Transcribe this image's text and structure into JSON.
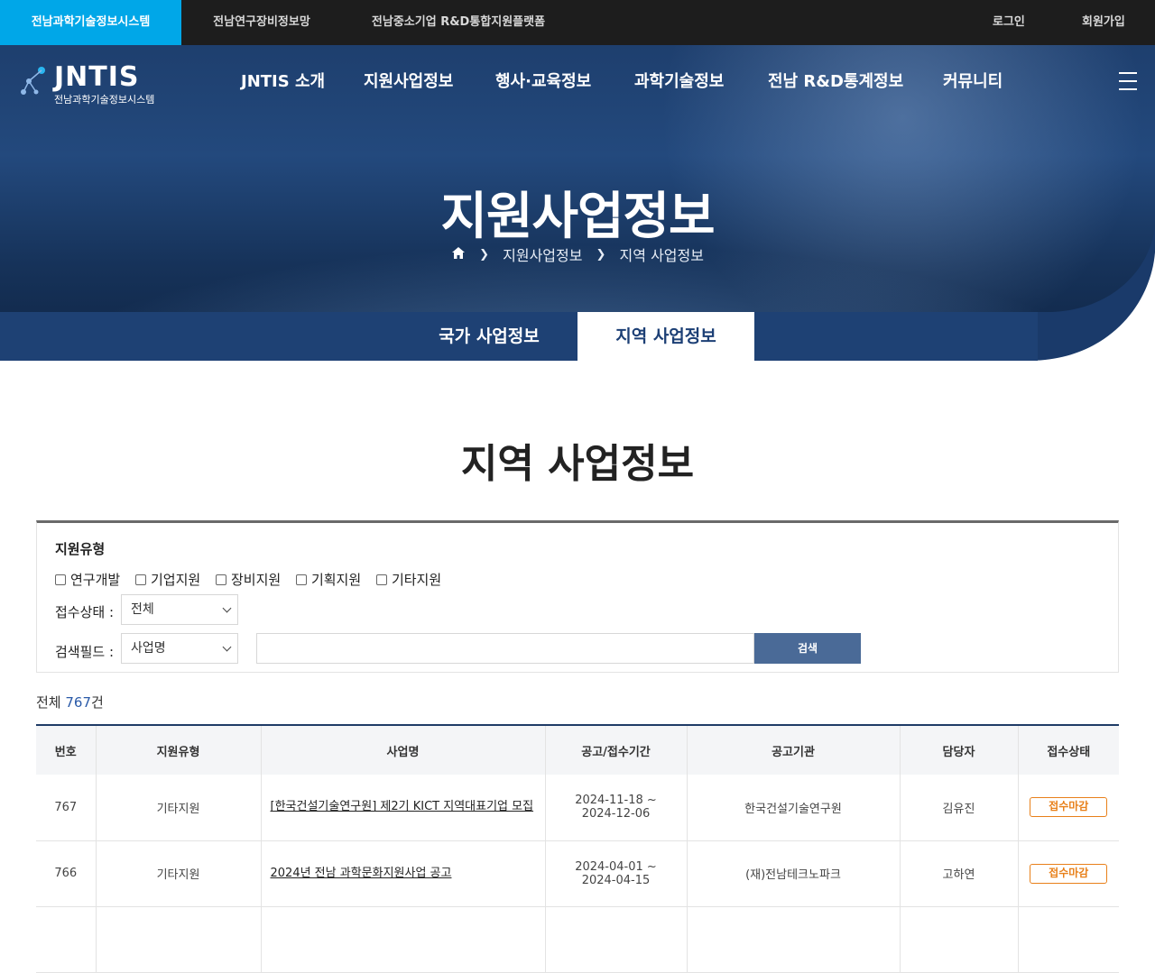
{
  "topbar": {
    "sites": [
      {
        "label": "전남과학기술정보시스템",
        "active": true
      },
      {
        "label": "전남연구장비정보망",
        "active": false
      },
      {
        "label": "전남중소기업 R&D통합지원플랫폼",
        "active": false
      }
    ],
    "login": "로그인",
    "signup": "회원가입"
  },
  "logo": {
    "text": "JNTIS",
    "sub": "전남과학기술정보시스템"
  },
  "gnb": [
    "JNTIS 소개",
    "지원사업정보",
    "행사·교육정보",
    "과학기술정보",
    "전남 R&D통계정보",
    "커뮤니티"
  ],
  "hero": {
    "title": "지원사업정보",
    "breadcrumb": [
      "지원사업정보",
      "지역 사업정보"
    ]
  },
  "subtabs": [
    {
      "label": "국가 사업정보",
      "active": false
    },
    {
      "label": "지역 사업정보",
      "active": true
    }
  ],
  "page_title": "지역 사업정보",
  "search": {
    "type_label": "지원유형",
    "types": [
      "연구개발",
      "기업지원",
      "장비지원",
      "기획지원",
      "기타지원"
    ],
    "status_label": "접수상태 :",
    "status_value": "전체",
    "field_label": "검색필드 :",
    "field_value": "사업명",
    "keyword": "",
    "button": "검색"
  },
  "total": {
    "prefix": "전체 ",
    "count": "767",
    "suffix": "건"
  },
  "table": {
    "headers": [
      "번호",
      "지원유형",
      "사업명",
      "공고/접수기간",
      "공고기관",
      "담당자",
      "접수상태"
    ],
    "rows": [
      {
        "no": "767",
        "type": "기타지원",
        "title": "[한국건설기술연구원] 제2기 KICT 지역대표기업 모집",
        "start": "2024-11-18 ~",
        "end": "2024-12-06",
        "org": "한국건설기술연구원",
        "manager": "김유진",
        "status": "접수마감"
      },
      {
        "no": "766",
        "type": "기타지원",
        "title": "2024년 전남 과학문화지원사업 공고",
        "start": "2024-04-01 ~",
        "end": "2024-04-15",
        "org": "(재)전남테크노파크",
        "manager": "고하연",
        "status": "접수마감"
      }
    ]
  },
  "colors": {
    "accent": "#00a7e8",
    "navy": "#1e3b66",
    "button": "#4a6a97",
    "status": "#e8801a"
  }
}
